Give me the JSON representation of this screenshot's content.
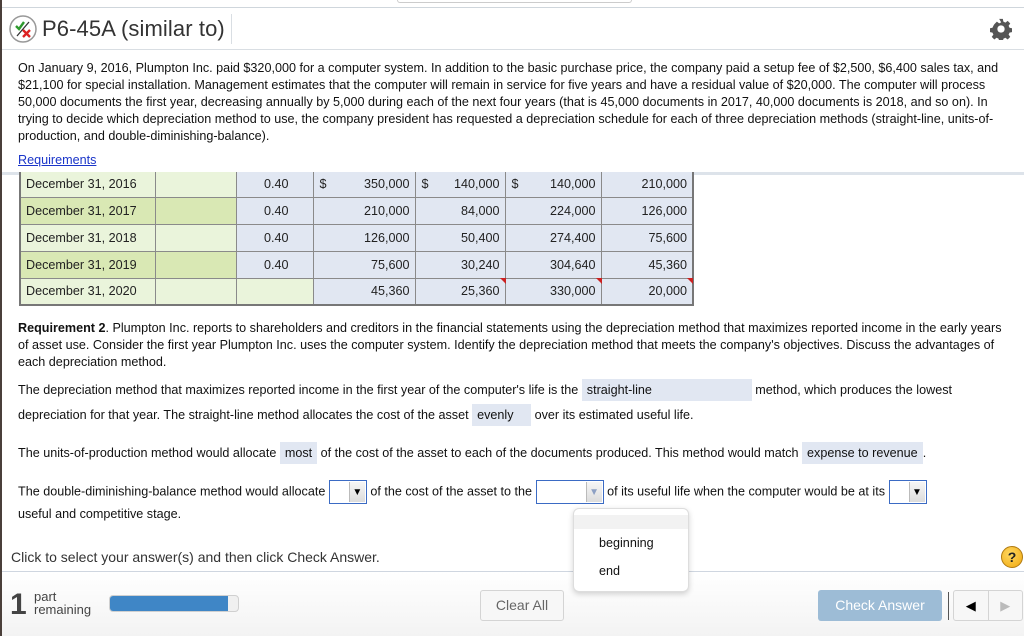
{
  "header": {
    "title": "P6-45A (similar to)",
    "status_icon": "partially-correct-icon",
    "settings_icon": "gear-icon"
  },
  "problem": {
    "text": "On January 9, 2016, Plumpton Inc. paid $320,000 for a computer system. In addition to the basic purchase price, the company paid a setup fee of $2,500, $6,400 sales tax, and $21,100 for special installation. Management estimates that the computer will remain in service for five years and have a residual value of $20,000. The computer will process 50,000 documents the first year, decreasing annually by 5,000 during each of the next four years (that is 45,000 documents in 2017, 40,000 documents is 2018, and so on). In trying to decide which depreciation method to use, the company president has requested a depreciation schedule for each of three depreciation methods (straight-line, units-of-production, and double-diminishing-balance).",
    "requirements_link": "Requirements"
  },
  "schedule": {
    "rows": [
      {
        "date": "December 31, 2016",
        "rate": "0.40",
        "book_value_begin": "350,000",
        "depreciation": "140,000",
        "accumulated": "140,000",
        "book_value_end": "210,000",
        "dollar": "$"
      },
      {
        "date": "December 31, 2017",
        "rate": "0.40",
        "book_value_begin": "210,000",
        "depreciation": "84,000",
        "accumulated": "224,000",
        "book_value_end": "126,000"
      },
      {
        "date": "December 31, 2018",
        "rate": "0.40",
        "book_value_begin": "126,000",
        "depreciation": "50,400",
        "accumulated": "274,400",
        "book_value_end": "75,600"
      },
      {
        "date": "December 31, 2019",
        "rate": "0.40",
        "book_value_begin": "75,600",
        "depreciation": "30,240",
        "accumulated": "304,640",
        "book_value_end": "45,360"
      },
      {
        "date": "December 31, 2020",
        "rate": "",
        "book_value_begin": "45,360",
        "depreciation": "25,360",
        "accumulated": "330,000",
        "book_value_end": "20,000"
      }
    ]
  },
  "requirement2": {
    "bold": "Requirement 2",
    "text": ". Plumpton Inc. reports to shareholders and creditors in the financial statements using the depreciation method that maximizes reported income in the early years of asset use. Consider the first year Plumpton Inc. uses the computer system. Identify the depreciation method that meets the company's objectives. Discuss the advantages of each depreciation method."
  },
  "sentence1": {
    "a": "The depreciation method that maximizes reported income in the first year of the computer's life is the",
    "answer": "straight-line",
    "b": "method, which produces the lowest"
  },
  "sentence2": {
    "a": "depreciation for that year. The straight-line method allocates the cost of the asset",
    "answer": "evenly",
    "b": "over its estimated useful life."
  },
  "sentence3": {
    "a": "The units-of-production method would allocate",
    "answer1": "most",
    "b": "of the cost of the asset to each of the documents produced. This method would match",
    "answer2": "expense to revenue",
    "c": "."
  },
  "sentence4": {
    "a": "The double-diminishing-balance method would allocate",
    "b": "of the cost of the asset to the",
    "c": "of its useful life when the computer would be at its",
    "d": "useful and competitive stage.",
    "dropdown1_value": "",
    "dropdown2_value": "",
    "dropdown3_value": ""
  },
  "dropdown_menu": {
    "options": [
      "",
      "beginning",
      "end"
    ]
  },
  "footer": {
    "instruction": "Click to select your answer(s) and then click Check Answer.",
    "parts_count": "1",
    "parts_label_1": "part",
    "parts_label_2": "remaining",
    "progress_percent": 92,
    "clear_all": "Clear All",
    "check_answer": "Check Answer",
    "help": "?",
    "prev": "◀",
    "next": "▶"
  }
}
